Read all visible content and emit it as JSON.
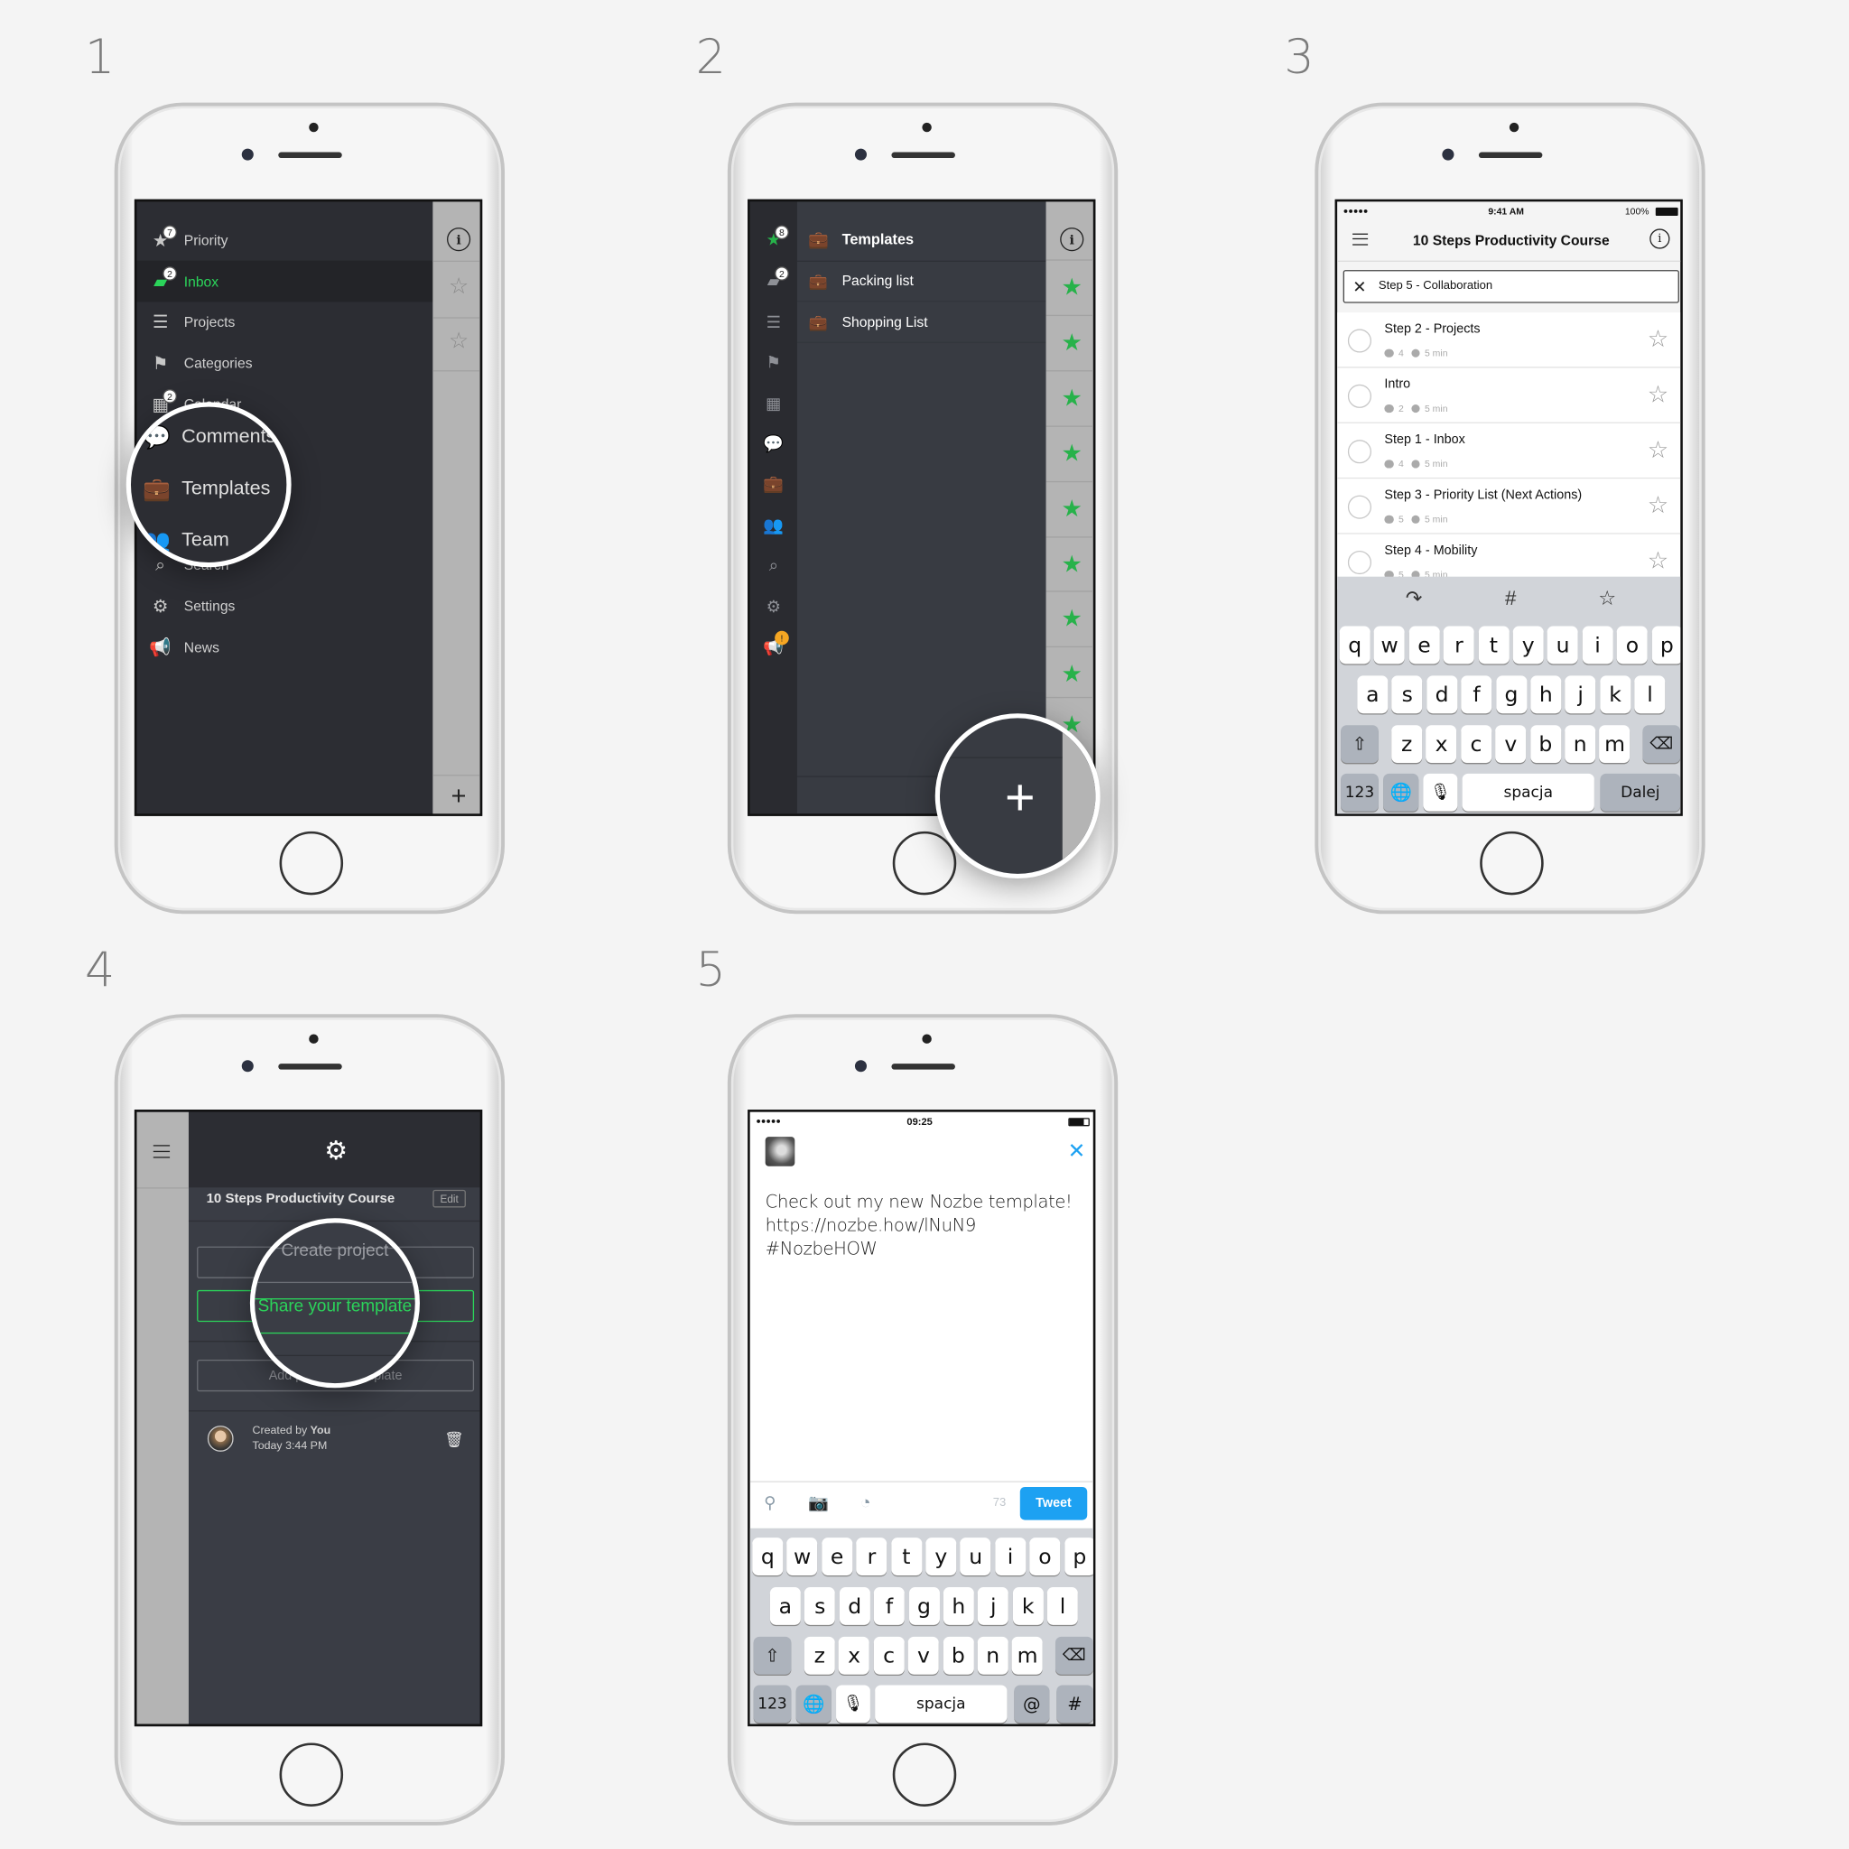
{
  "steps": [
    "1",
    "2",
    "3",
    "4",
    "5"
  ],
  "colors": {
    "accent_green": "#2bd45a",
    "star_green": "#27b24a",
    "tweet_blue": "#1da1f2",
    "sidebar_dark": "#2c2d33",
    "panel_dark": "#3a3d45",
    "strip_gray": "#b4b4b4"
  },
  "screen1": {
    "menu": [
      {
        "label": "Priority",
        "icon": "star-icon",
        "badge": "7"
      },
      {
        "label": "Inbox",
        "icon": "inbox-icon",
        "badge": "2",
        "active": true
      },
      {
        "label": "Projects",
        "icon": "projects-icon"
      },
      {
        "label": "Categories",
        "icon": "flag-icon"
      },
      {
        "label": "Calendar",
        "icon": "calendar-icon",
        "badge": "2"
      },
      {
        "label": "Search",
        "icon": "search-icon"
      },
      {
        "label": "Settings",
        "icon": "gear-icon"
      },
      {
        "label": "News",
        "icon": "megaphone-icon"
      }
    ],
    "magnified": [
      {
        "label": "Comments",
        "icon": "comments-icon"
      },
      {
        "label": "Templates",
        "icon": "briefcase-icon"
      },
      {
        "label": "Team",
        "icon": "team-icon"
      }
    ],
    "strip": {
      "info_icon": "info-icon",
      "star_icon": "star-outline-icon",
      "add_icon": "plus-icon"
    }
  },
  "screen2": {
    "header": "Templates",
    "items": [
      "Packing list",
      "Shopping List"
    ],
    "priority_badge": "8",
    "inbox_badge": "2",
    "calendar_badge": "2",
    "news_badge": "!",
    "star_count": 9
  },
  "screen3": {
    "status": {
      "carrier": "●●●●● ",
      "time": "9:41 AM",
      "battery": "100%"
    },
    "title": "10 Steps Productivity Course",
    "search_value": "Step 5 - Collaboration",
    "tasks": [
      {
        "title": "Step 2 - Projects",
        "comments": "4",
        "time": "5 min"
      },
      {
        "title": "Intro",
        "comments": "2",
        "time": "5 min"
      },
      {
        "title": "Step 1 - Inbox",
        "comments": "4",
        "time": "5 min"
      },
      {
        "title": "Step 3 - Priority List (Next Actions)",
        "comments": "5",
        "time": "5 min"
      },
      {
        "title": "Step 4 - Mobility",
        "comments": "5",
        "time": "5 min"
      }
    ],
    "toolbar": [
      "↷",
      "#",
      "☆"
    ],
    "keyboard": {
      "rows": [
        [
          "q",
          "w",
          "e",
          "r",
          "t",
          "y",
          "u",
          "i",
          "o",
          "p"
        ],
        [
          "a",
          "s",
          "d",
          "f",
          "g",
          "h",
          "j",
          "k",
          "l"
        ],
        [
          "z",
          "x",
          "c",
          "v",
          "b",
          "n",
          "m"
        ]
      ],
      "numbers": "123",
      "space": "spacja",
      "action": "Dalej"
    }
  },
  "screen4": {
    "project_title": "10 Steps Productivity Course",
    "edit": "Edit",
    "create_project": "Create project",
    "share_template": "Share your template",
    "add_to_template": "Add project to template",
    "created_by_prefix": "Created by ",
    "created_by": "You",
    "created_time": "Today 3:44 PM"
  },
  "screen5": {
    "status": {
      "carrier": "●●●●●",
      "time": "09:25"
    },
    "tweet_lines": [
      "Check out my new Nozbe template!",
      "https://nozbe.how/lNuN9",
      "#NozbeHOW"
    ],
    "char_count": "73",
    "tweet_button": "Tweet",
    "keyboard": {
      "rows": [
        [
          "q",
          "w",
          "e",
          "r",
          "t",
          "y",
          "u",
          "i",
          "o",
          "p"
        ],
        [
          "a",
          "s",
          "d",
          "f",
          "g",
          "h",
          "j",
          "k",
          "l"
        ],
        [
          "z",
          "x",
          "c",
          "v",
          "b",
          "n",
          "m"
        ]
      ],
      "numbers": "123",
      "space": "spacja",
      "extra": [
        "@",
        "#"
      ]
    }
  }
}
